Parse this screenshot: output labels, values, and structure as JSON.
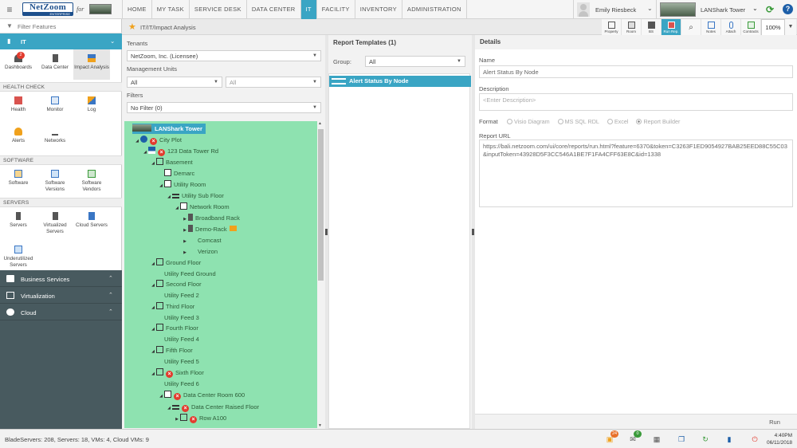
{
  "header": {
    "logo_brand": "NetZoom",
    "logo_sub": "ENTERPRISE",
    "logo_for": "for",
    "tabs": [
      {
        "label": "HOME",
        "active": false
      },
      {
        "label": "MY TASK",
        "active": false
      },
      {
        "label": "SERVICE DESK",
        "active": false
      },
      {
        "label": "DATA CENTER",
        "active": false
      },
      {
        "label": "IT",
        "active": true
      },
      {
        "label": "FACILITY",
        "active": false
      },
      {
        "label": "INVENTORY",
        "active": false
      },
      {
        "label": "ADMINISTRATION",
        "active": false
      }
    ],
    "user_name": "Emily Riesbeck",
    "site_name": "LANShark Tower"
  },
  "sidebar": {
    "filter_placeholder": "Filter Features",
    "section": "IT",
    "top_tiles": [
      {
        "label": "Dashboards",
        "badge": "2"
      },
      {
        "label": "Data Center"
      },
      {
        "label": "Impact Analysis"
      }
    ],
    "health_title": "HEALTH CHECK",
    "health_tiles": [
      "Health",
      "Monitor",
      "Log",
      "Alerts",
      "Networks"
    ],
    "software_title": "SOFTWARE",
    "software_tiles": [
      "Software",
      "Software Versions",
      "Software Vendors"
    ],
    "servers_title": "SERVERS",
    "servers_tiles": [
      "Servers",
      "Virtualized Servers",
      "Cloud Servers",
      "Underutilized Servers"
    ],
    "groups": [
      "Business Services",
      "Virtualization",
      "Cloud"
    ]
  },
  "breadcrumb": "IT/IT/Impact Analysis",
  "toolbar": {
    "buttons": [
      "Property",
      "Room",
      "BS",
      "Run Rep.",
      "Notes",
      "Attach",
      "Contracts"
    ],
    "zoom": "100%"
  },
  "left": {
    "tenants_label": "Tenants",
    "tenant_value": "NetZoom, Inc. (Licensee)",
    "mu_label": "Management Units",
    "mu_value_1": "All",
    "mu_value_2": "All",
    "filters_label": "Filters",
    "filter_value": "No Filter (0)",
    "tree": [
      "LANShark Tower",
      "City Plot",
      "123 Data Tower Rd",
      "Basement",
      "Demarc",
      "Utility Room",
      "Utility Sub Floor",
      "Network Room",
      "Broadband Rack",
      "Demo-Rack",
      "Comcast",
      "Verizon",
      "Ground Floor",
      "Utility Feed Ground",
      "Second Floor",
      "Utility Feed 2",
      "Third Floor",
      "Utility Feed 3",
      "Fourth Floor",
      "Utility Feed 4",
      "Fifth Floor",
      "Utility Feed 5",
      "Sixth Floor",
      "Utility Feed 6",
      "Data Center Room 600",
      "Data Center Raised Floor",
      "Row A100"
    ]
  },
  "middle": {
    "title": "Report Templates (1)",
    "group_label": "Group:",
    "group_value": "All",
    "item": "Alert Status By Node"
  },
  "details": {
    "title": "Details",
    "name_label": "Name",
    "name_value": "Alert Status By Node",
    "desc_label": "Description",
    "desc_placeholder": "<Enter Description>",
    "format_label": "Format",
    "formats": [
      "Visio Diagram",
      "MS SQL RDL",
      "Excel",
      "Report Builder"
    ],
    "selected_format": "Report Builder",
    "url_label": "Report URL",
    "url_value": "https://bali.netzoom.com/ui/core/reports/run.html?feature=6370&token=C3263F1ED9054927BAB25EED88C55C03&inputToken=43928D5F3CC546A1BE7F1FA4CFF63E8C&id=1338",
    "run_label": "Run"
  },
  "status": {
    "text": "BladeServers: 208, Servers: 18, VMs: 4, Cloud VMs: 9",
    "notif_badge": "24",
    "msg_badge": "0",
    "time": "4:40PM",
    "date": "06/11/2018"
  },
  "colors": {
    "accent": "#3aa5c4",
    "tree_bg": "#8ee2b0",
    "sidebar_dark": "#485a5f",
    "error": "#e23b2e"
  }
}
